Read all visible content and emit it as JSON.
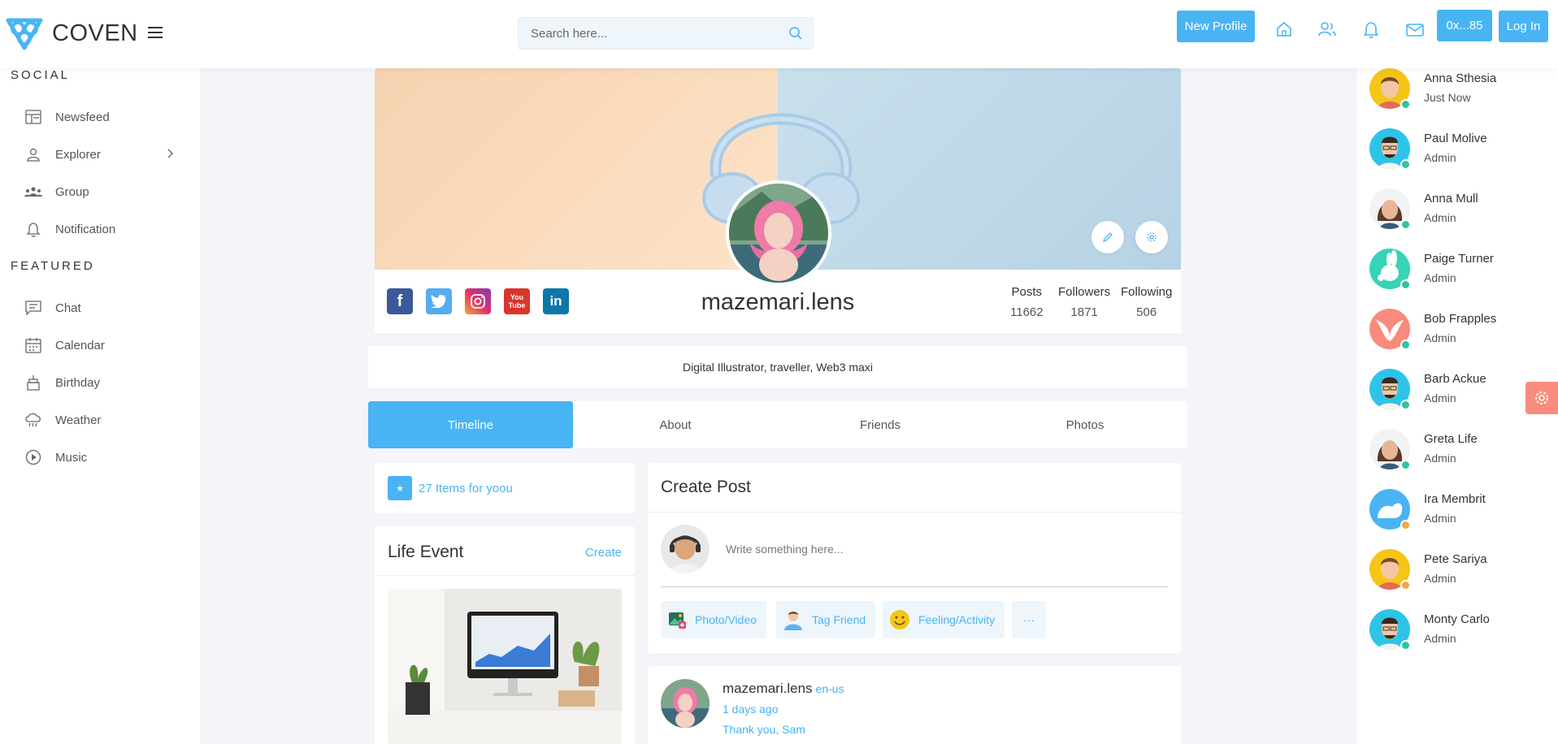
{
  "header": {
    "app_name": "COVEN",
    "search_placeholder": "Search here...",
    "new_profile_label": "New Profile",
    "wallet_label": "0x...85",
    "login_label": "Log In",
    "icons": [
      "home-icon",
      "users-icon",
      "bell-icon",
      "mail-icon"
    ]
  },
  "sidebar": {
    "social_title": "SOCIAL",
    "social_items": [
      {
        "label": "Newsfeed",
        "icon": "newsfeed-icon"
      },
      {
        "label": "Explorer",
        "icon": "user-icon"
      },
      {
        "label": "Group",
        "icon": "group-icon"
      },
      {
        "label": "Notification",
        "icon": "bell-icon"
      }
    ],
    "featured_title": "FEATURED",
    "featured_items": [
      {
        "label": "Chat",
        "icon": "chat-icon"
      },
      {
        "label": "Calendar",
        "icon": "calendar-icon"
      },
      {
        "label": "Birthday",
        "icon": "cake-icon"
      },
      {
        "label": "Weather",
        "icon": "cloud-rain-icon"
      },
      {
        "label": "Music",
        "icon": "play-icon"
      }
    ]
  },
  "profile": {
    "username": "mazemari.lens",
    "bio": "Digital Illustrator, traveller, Web3 maxi",
    "stats": [
      {
        "label": "Posts",
        "value": "11662"
      },
      {
        "label": "Followers",
        "value": "1871"
      },
      {
        "label": "Following",
        "value": "506"
      }
    ],
    "social_links": [
      "facebook",
      "twitter",
      "instagram",
      "youtube",
      "linkedin"
    ]
  },
  "tabs": [
    {
      "label": "Timeline",
      "active": true
    },
    {
      "label": "About",
      "active": false
    },
    {
      "label": "Friends",
      "active": false
    },
    {
      "label": "Photos",
      "active": false
    }
  ],
  "items_card": {
    "label": "27 Items for yoou"
  },
  "life_event": {
    "title": "Life Event",
    "create_label": "Create"
  },
  "create_post": {
    "title": "Create Post",
    "placeholder": "Write something here...",
    "actions": [
      {
        "label": "Photo/Video",
        "icon": "photo-icon"
      },
      {
        "label": "Tag Friend",
        "icon": "tag-friend-icon"
      },
      {
        "label": "Feeling/Activity",
        "icon": "smile-icon"
      }
    ],
    "more_label": "···"
  },
  "post": {
    "author": "mazemari.lens",
    "locale": "en-us",
    "time": "1 days ago",
    "text": "Thank you, Sam"
  },
  "contacts": [
    {
      "name": "Anna Sthesia",
      "role": "Just Now",
      "status": "online",
      "avatar_color": "#f5c518"
    },
    {
      "name": "Paul Molive",
      "role": "Admin",
      "status": "online",
      "avatar_color": "#2ec4e8"
    },
    {
      "name": "Anna Mull",
      "role": "Admin",
      "status": "online",
      "avatar_color": "#f3f3f3"
    },
    {
      "name": "Paige Turner",
      "role": "Admin",
      "status": "online",
      "avatar_color": "#37d3b6"
    },
    {
      "name": "Bob Frapples",
      "role": "Admin",
      "status": "online",
      "avatar_color": "#f88b7b"
    },
    {
      "name": "Barb Ackue",
      "role": "Admin",
      "status": "online",
      "avatar_color": "#2ec4e8"
    },
    {
      "name": "Greta Life",
      "role": "Admin",
      "status": "online",
      "avatar_color": "#f3f3f3"
    },
    {
      "name": "Ira Membrit",
      "role": "Admin",
      "status": "away",
      "avatar_color": "#48b4f4"
    },
    {
      "name": "Pete Sariya",
      "role": "Admin",
      "status": "away",
      "avatar_color": "#f5c518"
    },
    {
      "name": "Monty Carlo",
      "role": "Admin",
      "status": "online",
      "avatar_color": "#2ec4e8"
    }
  ],
  "colors": {
    "accent": "#48b4f4",
    "online": "#2dc4a0",
    "away": "#f5a54a",
    "settings_tab": "#f98c7c"
  }
}
